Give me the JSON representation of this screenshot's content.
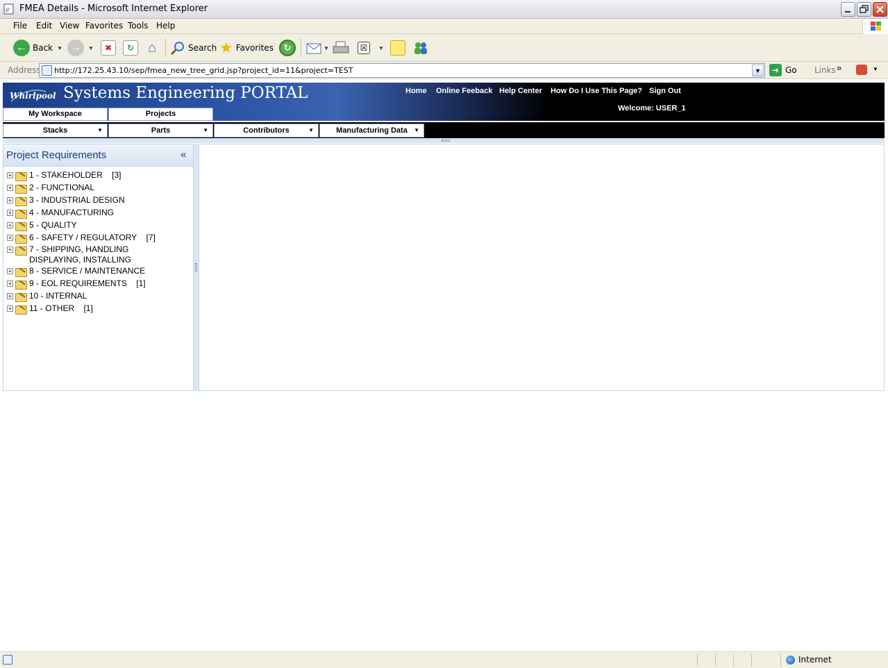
{
  "window": {
    "title": "FMEA Details - Microsoft Internet Explorer"
  },
  "menubar": [
    "File",
    "Edit",
    "View",
    "Favorites",
    "Tools",
    "Help"
  ],
  "toolbar": {
    "back": "Back",
    "search": "Search",
    "favorites": "Favorites"
  },
  "address": {
    "label": "Address",
    "url": "http://172.25.43.10/sep/fmea_new_tree_grid.jsp?project_id=11&project=TEST",
    "go": "Go",
    "links": "Links"
  },
  "portal": {
    "logo": "Whirlpool",
    "title": "Systems Engineering PORTAL",
    "links": [
      "Home",
      "Online Feeback",
      "Help Center",
      "How Do I Use This Page?",
      "Sign Out"
    ],
    "welcome": "Welcome: USER_1",
    "tabs": [
      "My Workspace",
      "Projects"
    ],
    "subtabs": [
      "Stacks",
      "Parts",
      "Contributors",
      "Manufacturing Data"
    ]
  },
  "panel": {
    "title": "Project Requirements",
    "collapse": "«"
  },
  "tree": [
    {
      "label": "1 - STAKEHOLDER",
      "count": "[3]"
    },
    {
      "label": "2 - FUNCTIONAL",
      "count": ""
    },
    {
      "label": "3 - INDUSTRIAL DESIGN",
      "count": ""
    },
    {
      "label": "4 - MANUFACTURING",
      "count": ""
    },
    {
      "label": "5 - QUALITY",
      "count": ""
    },
    {
      "label": "6 - SAFETY / REGULATORY",
      "count": "[7]"
    },
    {
      "label": "7 - SHIPPING, HANDLING DISPLAYING, INSTALLING",
      "count": ""
    },
    {
      "label": "8 - SERVICE / MAINTENANCE",
      "count": ""
    },
    {
      "label": "9 - EOL REQUIREMENTS",
      "count": "[1]"
    },
    {
      "label": "10 - INTERNAL",
      "count": ""
    },
    {
      "label": "11 - OTHER",
      "count": "[1]"
    }
  ],
  "status": {
    "zone": "Internet"
  }
}
